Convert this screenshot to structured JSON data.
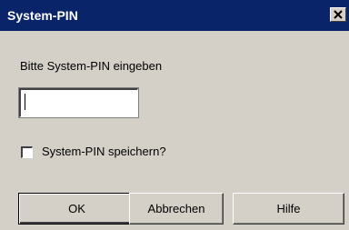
{
  "window": {
    "title": "System-PIN",
    "close_icon": "close-icon"
  },
  "form": {
    "prompt_label": "Bitte System-PIN eingeben",
    "pin_value": "",
    "save_checkbox_label": "System-PIN speichern?",
    "save_checked": false
  },
  "buttons": {
    "ok": "OK",
    "cancel": "Abbrechen",
    "help": "Hilfe"
  },
  "colors": {
    "titlebar": "#0a246a",
    "dialog_background": "#d4d0c8"
  }
}
